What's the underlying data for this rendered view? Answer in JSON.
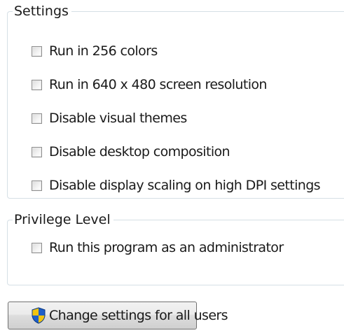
{
  "settings": {
    "title": "Settings",
    "options": [
      {
        "label": "Run in 256 colors",
        "checked": false
      },
      {
        "label": "Run in 640 x 480 screen resolution",
        "checked": false
      },
      {
        "label": "Disable visual themes",
        "checked": false
      },
      {
        "label": "Disable desktop composition",
        "checked": false
      },
      {
        "label": "Disable display scaling on high DPI settings",
        "checked": false
      }
    ]
  },
  "privilege": {
    "title": "Privilege Level",
    "options": [
      {
        "label": "Run this program as an administrator",
        "checked": false
      }
    ]
  },
  "change_button": {
    "label": "Change settings for all users",
    "icon": "uac-shield-icon"
  },
  "colors": {
    "group_border": "#d5dfe5",
    "button_border": "#707070",
    "shield_blue": "#1f5fc8",
    "shield_yellow": "#f2c40f"
  }
}
